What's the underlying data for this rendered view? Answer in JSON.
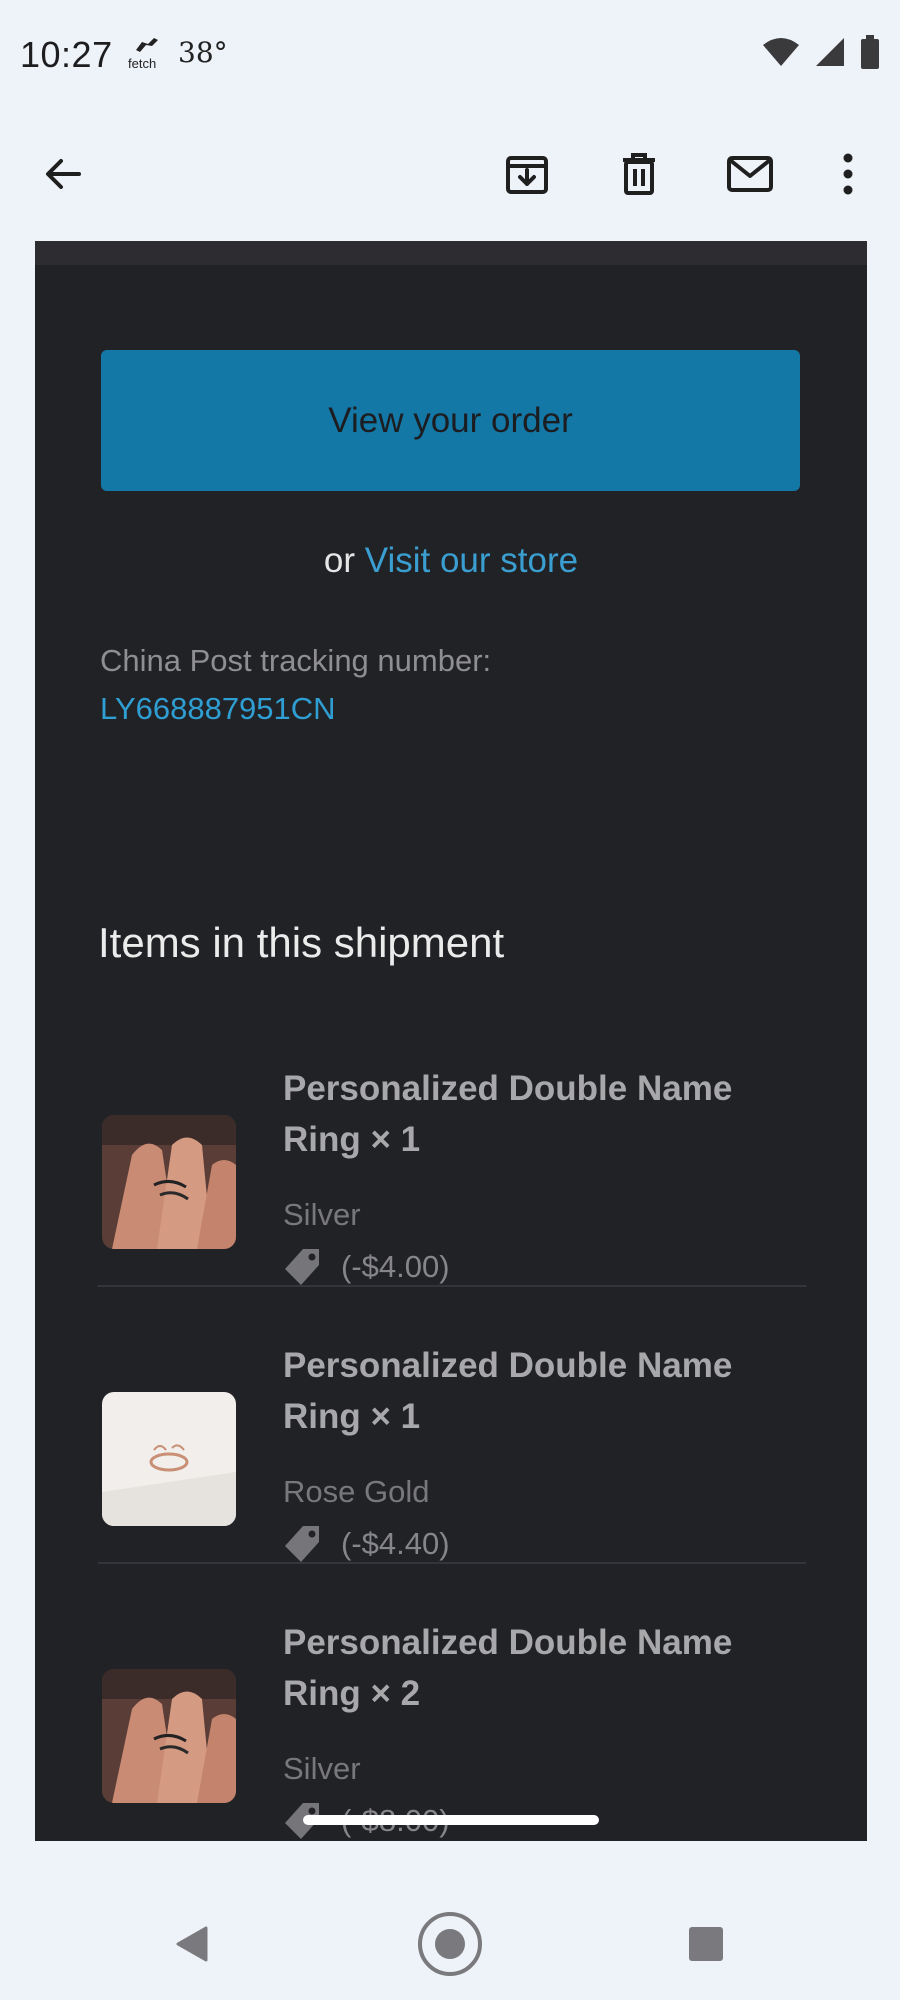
{
  "status_bar": {
    "time": "10:27",
    "fetch_label": "fetch",
    "temperature": "38°",
    "icons": [
      "wifi-icon",
      "cell-signal-icon",
      "battery-icon"
    ]
  },
  "toolbar": {
    "icons": [
      "back-arrow-icon",
      "archive-icon",
      "delete-icon",
      "mark-unread-icon",
      "more-vert-icon"
    ]
  },
  "email": {
    "cta_label": "View your order",
    "or_text": "or",
    "visit_store_link": "Visit our store",
    "tracking_label": "China Post tracking number:",
    "tracking_number": "LY668887951CN",
    "section_title": "Items in this shipment",
    "items": [
      {
        "name": "Personalized Double Name Ring × 1",
        "variant": "Silver",
        "discount": "(-$4.00)",
        "image": "hand-ring-photo"
      },
      {
        "name": "Personalized Double Name Ring × 1",
        "variant": "Rose Gold",
        "discount": "(-$4.40)",
        "image": "rose-gold-ring-photo"
      },
      {
        "name": "Personalized Double Name Ring × 2",
        "variant": "Silver",
        "discount": "(-$8.00)",
        "image": "hand-ring-photo"
      }
    ]
  },
  "colors": {
    "email_bg": "#212226",
    "cta_bg": "#1478a6",
    "link": "#3a9fd0",
    "system_bg": "#eef2f9"
  },
  "navigation": {
    "icons": [
      "back-triangle-icon",
      "home-circle-icon",
      "recents-square-icon"
    ]
  }
}
